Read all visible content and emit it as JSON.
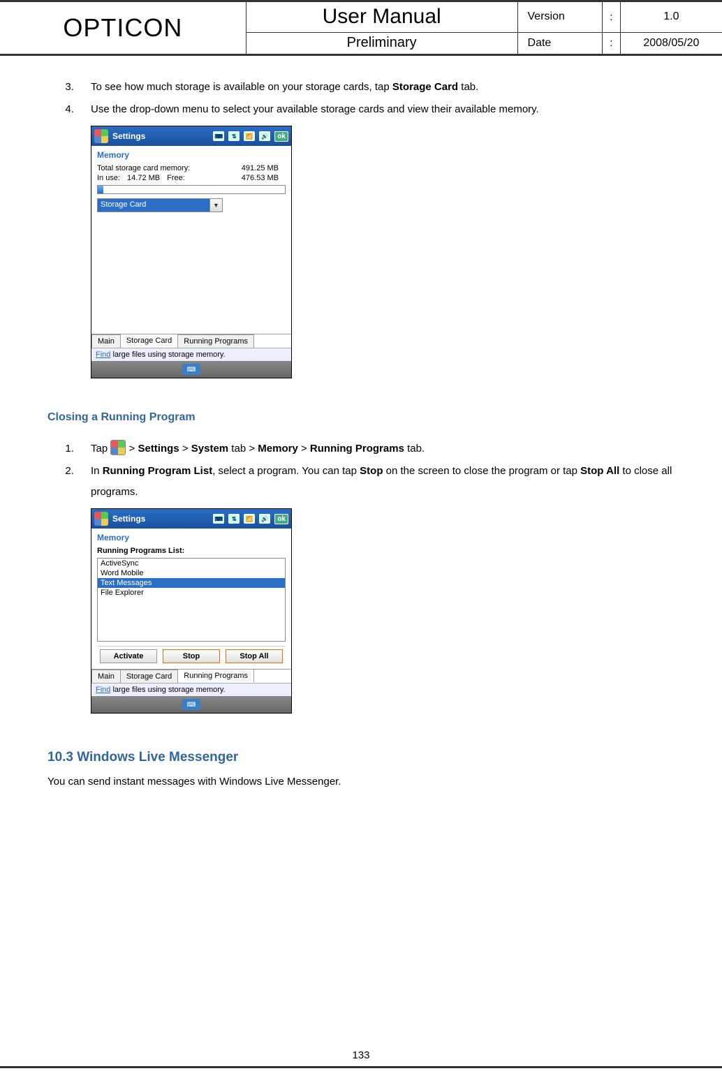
{
  "header": {
    "logo": "OPTICON",
    "title": "User Manual",
    "subtitle": "Preliminary",
    "version_label": "Version",
    "version_value": "1.0",
    "date_label": "Date",
    "date_value": "2008/05/20",
    "colon": ":"
  },
  "body": {
    "step3_num": "3.",
    "step3_a": "To see how much storage is available on your storage cards, tap ",
    "step3_b_bold": "Storage Card",
    "step3_c": " tab.",
    "step4_num": "4.",
    "step4_text": "Use the drop-down menu to select your available storage cards and view their available memory.",
    "section_close_title": "Closing a Running Program",
    "close_step1_num": "1.",
    "close_step1_tap": "Tap ",
    "close_step1_gt": " > ",
    "close_step1_settings": "Settings",
    "close_step1_system": "System",
    "close_step1_tab": " tab > ",
    "close_step1_memory": "Memory",
    "close_step1_running": "Running Programs",
    "close_step1_tab2": " tab.",
    "close_step2_num": "2.",
    "close_step2_a": "In ",
    "close_step2_b": "Running Program List",
    "close_step2_c": ", select a program. You can tap ",
    "close_step2_d": "Stop",
    "close_step2_e": " on the screen to close the program or tap ",
    "close_step2_f": "Stop All",
    "close_step2_g": " to close all programs.",
    "section_wlm_title": "10.3 Windows Live Messenger",
    "wlm_text": "You can send instant messages with Windows Live Messenger.",
    "page_number": "133"
  },
  "screenshot1": {
    "title": "Settings",
    "ok": "ok",
    "memory_heading": "Memory",
    "total_label": "Total storage card memory:",
    "total_value": "491.25 MB",
    "inuse_label": "In use:",
    "inuse_value": "14.72 MB",
    "free_label": "Free:",
    "free_value": "476.53 MB",
    "dropdown_selected": "Storage Card",
    "tabs": {
      "t1": "Main",
      "t2": "Storage Card",
      "t3": "Running Programs"
    },
    "find_link": "Find",
    "find_text": " large files using storage memory."
  },
  "screenshot2": {
    "title": "Settings",
    "ok": "ok",
    "memory_heading": "Memory",
    "list_heading": "Running Programs List:",
    "items": {
      "i1": "ActiveSync",
      "i2": "Word Mobile",
      "i3": "Text Messages",
      "i4": "File Explorer"
    },
    "btn_activate": "Activate",
    "btn_stop": "Stop",
    "btn_stopall": "Stop All",
    "tabs": {
      "t1": "Main",
      "t2": "Storage Card",
      "t3": "Running Programs"
    },
    "find_link": "Find",
    "find_text": " large files using storage memory."
  }
}
